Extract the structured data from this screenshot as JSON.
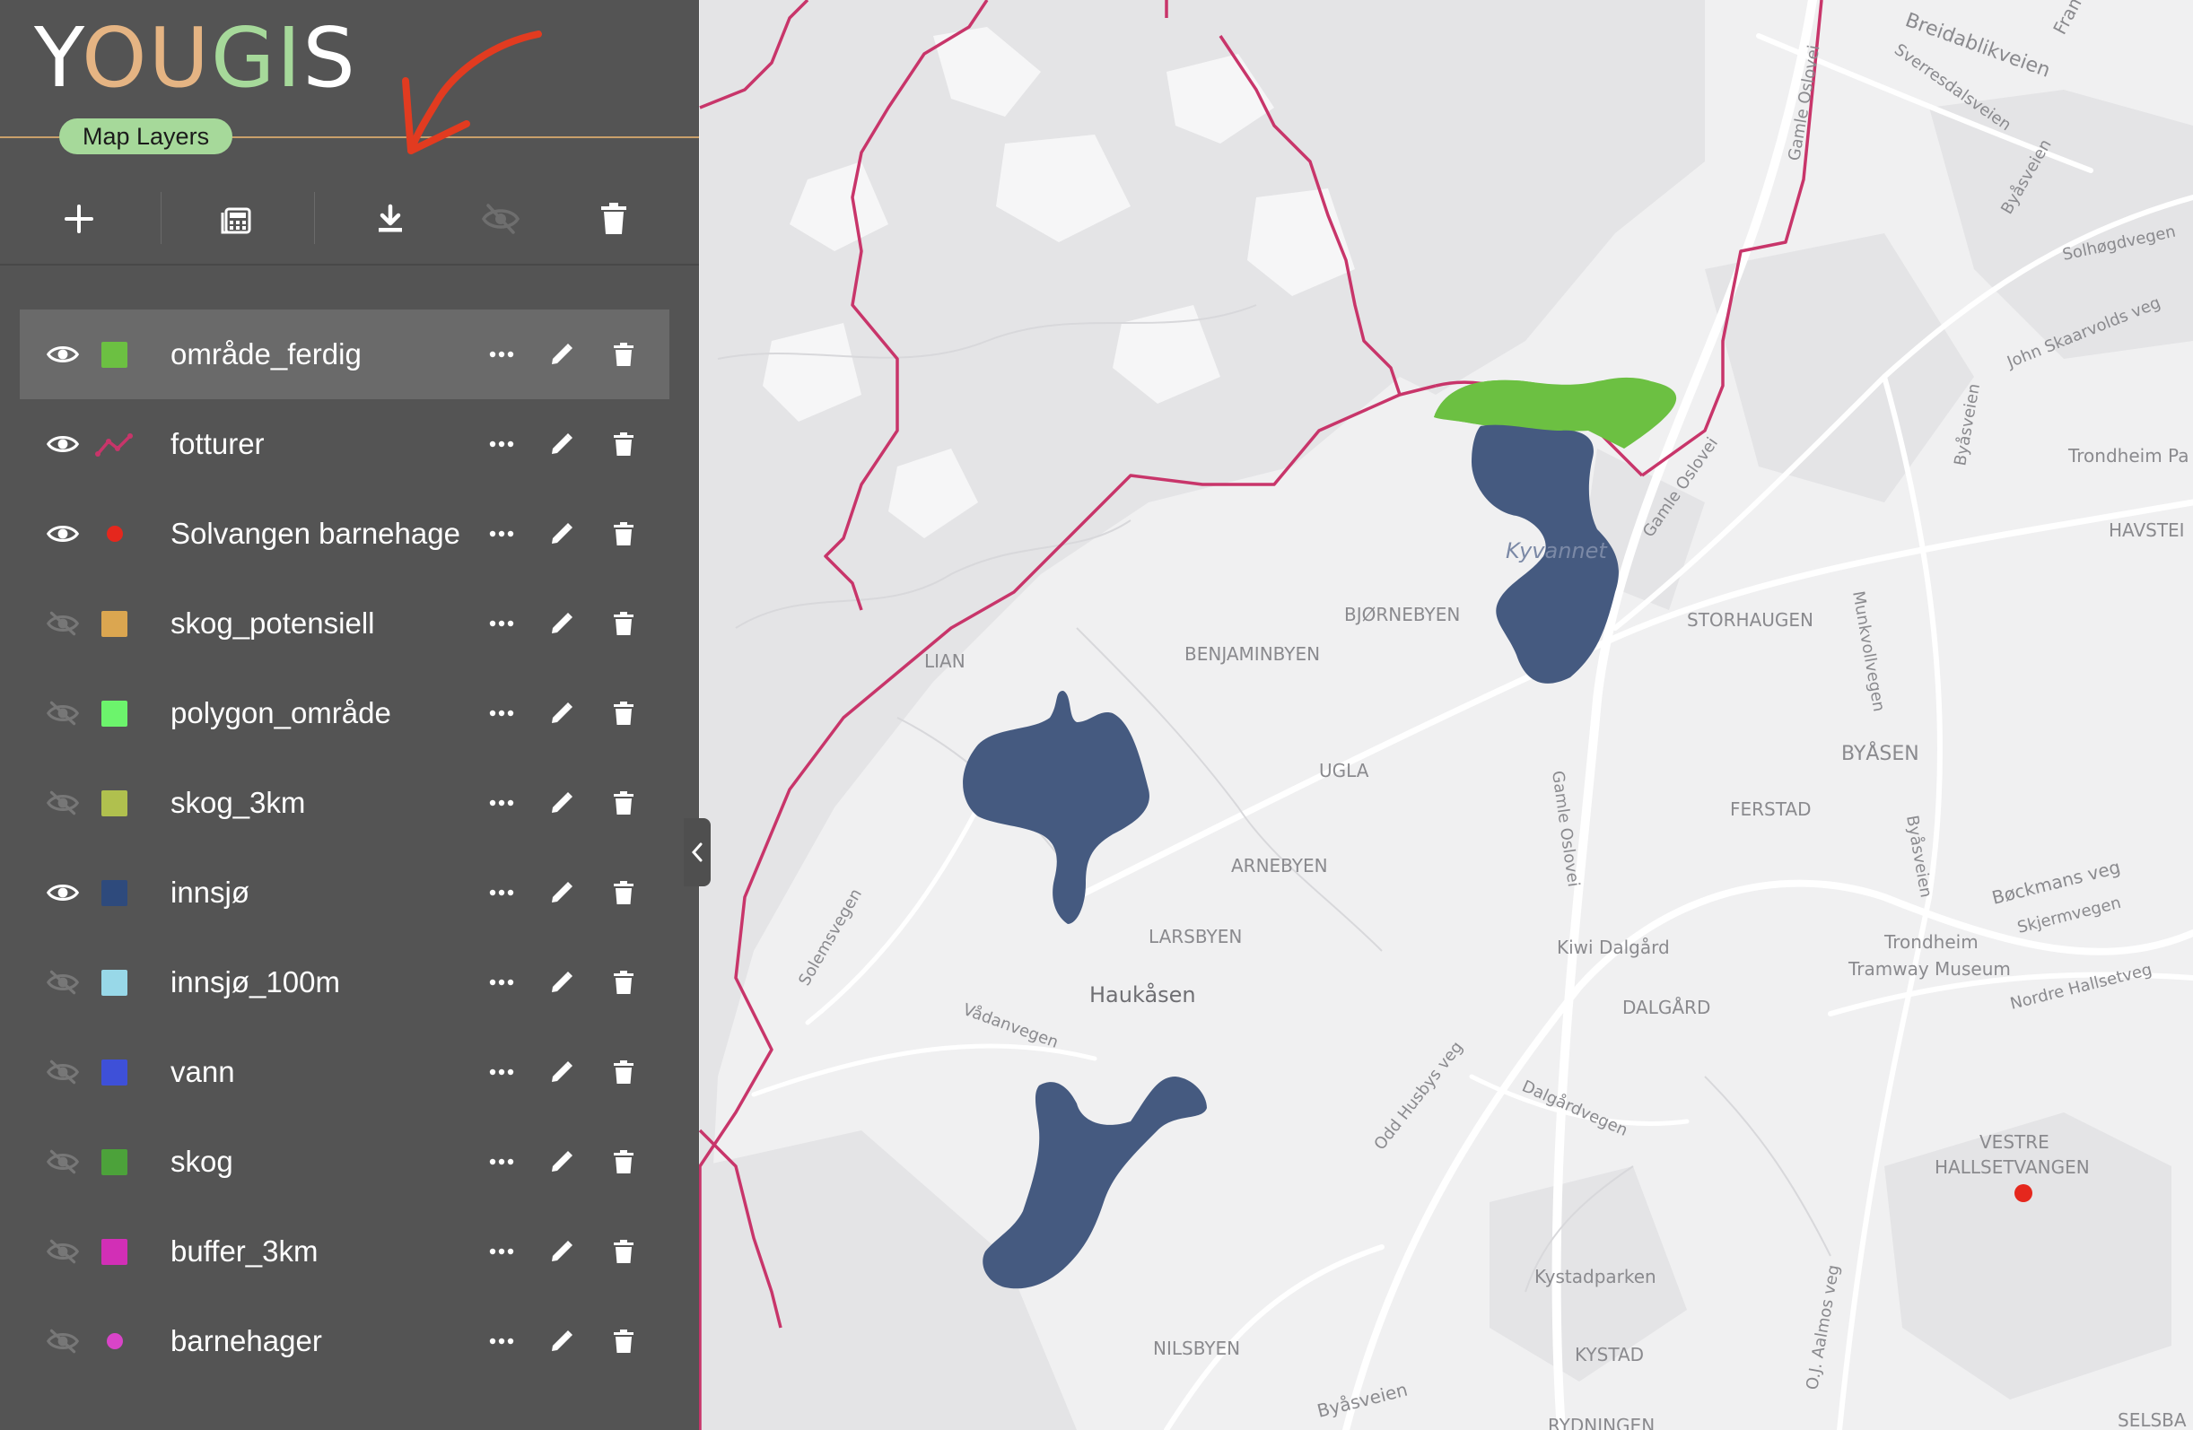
{
  "app": {
    "logo_letters": [
      {
        "ch": "Y",
        "color": "#ffffff"
      },
      {
        "ch": "O",
        "color": "#e5b483"
      },
      {
        "ch": "U",
        "color": "#e5b483"
      },
      {
        "ch": "G",
        "color": "#a6d99a"
      },
      {
        "ch": "I",
        "color": "#a6d99a"
      },
      {
        "ch": "S",
        "color": "#ffffff"
      }
    ],
    "logo_text": "YOUGIS",
    "panel_tab": "Map Layers",
    "accent_color": "#c9a06a"
  },
  "toolbar": {
    "buttons": [
      {
        "name": "add-layer",
        "icon": "plus-icon",
        "enabled": true
      },
      {
        "name": "calculator",
        "icon": "calculator-icon",
        "enabled": true
      },
      {
        "name": "download",
        "icon": "download-icon",
        "enabled": true
      },
      {
        "name": "hide-all",
        "icon": "eye-off-icon",
        "enabled": false
      },
      {
        "name": "delete-all",
        "icon": "trash-icon",
        "enabled": true
      }
    ]
  },
  "layers": [
    {
      "name": "område_ferdig",
      "visible": true,
      "symbol": "square",
      "color": "#6cc042",
      "selected": true
    },
    {
      "name": "fotturer",
      "visible": true,
      "symbol": "line",
      "color": "#c8356a",
      "selected": false
    },
    {
      "name": "Solvangen barnehage",
      "visible": true,
      "symbol": "dot",
      "color": "#e5271d",
      "selected": false
    },
    {
      "name": "skog_potensiell",
      "visible": false,
      "symbol": "square",
      "color": "#dba650",
      "selected": false
    },
    {
      "name": "polygon_område",
      "visible": false,
      "symbol": "square",
      "color": "#6cf46c",
      "selected": false
    },
    {
      "name": "skog_3km",
      "visible": false,
      "symbol": "square",
      "color": "#b0c04e",
      "selected": false
    },
    {
      "name": "innsjø",
      "visible": true,
      "symbol": "square",
      "color": "#2e4a7c",
      "selected": false
    },
    {
      "name": "innsjø_100m",
      "visible": false,
      "symbol": "square",
      "color": "#98d8e8",
      "selected": false
    },
    {
      "name": "vann",
      "visible": false,
      "symbol": "square",
      "color": "#3e50d8",
      "selected": false
    },
    {
      "name": "skog",
      "visible": false,
      "symbol": "square",
      "color": "#4ca23a",
      "selected": false
    },
    {
      "name": "buffer_3km",
      "visible": false,
      "symbol": "square",
      "color": "#d22fb6",
      "selected": false
    },
    {
      "name": "barnehager",
      "visible": false,
      "symbol": "dot",
      "color": "#d944c8",
      "selected": false
    }
  ],
  "map": {
    "labels": [
      "Breidablikveien",
      "Sverresdalsveien",
      "Framv",
      "Gamle Oslovei",
      "Byåsveien",
      "Solhøgdvegen",
      "John Skaarvolds veg",
      "Byåsveien",
      "Trondheim Pa",
      "HAVSTEI",
      "Gamle Oslovei",
      "BJØRNEBYEN",
      "STORHAUGEN",
      "Munkvollvegen",
      "BENJAMINBYEN",
      "LIAN",
      "UGLA",
      "BYÅSEN",
      "FERSTAD",
      "Byåsveien",
      "Gamle Oslovei",
      "ARNEBYEN",
      "Bøckmans veg",
      "Solemsvegen",
      "LARSBYEN",
      "Kiwi Dalgård",
      "Trondheim",
      "Tramway Museum",
      "Skjermvegen",
      "Haukåsen",
      "Nordre Hallsetveg",
      "Vådanvegen",
      "DALGÅRD",
      "Odd Husbys veg",
      "Dalgårdvegen",
      "VESTRE",
      "HALLSETVANGEN",
      "Kystadparken",
      "O.J. Aalmos veg",
      "NILSBYEN",
      "KYSTAD",
      "Byåsveien",
      "SELSBA",
      "RYDNINGEN",
      "Kyvannet"
    ],
    "lake_color": "#455a80",
    "area_color": "#6cc042",
    "trail_color": "#c8356a",
    "point_color": "#e5271d"
  }
}
